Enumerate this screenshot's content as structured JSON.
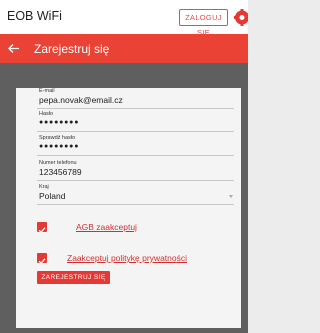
{
  "app": {
    "title": "EOB WiFi",
    "login_label": "ZALOGUJ SIĘ"
  },
  "header": {
    "title": "Zarejestruj się"
  },
  "form": {
    "email": {
      "label": "E-mail",
      "value": "pepa.novak@email.cz"
    },
    "password": {
      "label": "Hasło",
      "value": "●●●●●●●●"
    },
    "password_confirm": {
      "label": "Sprawdź hasło",
      "value": "●●●●●●●●"
    },
    "phone": {
      "label": "Numer telefonu",
      "value": "123456789"
    },
    "country": {
      "label": "Kraj",
      "value": "Poland"
    },
    "terms": {
      "label": "AGB zaakceptuj",
      "checked": true
    },
    "privacy": {
      "label": "Zaakceptuj politykę prywatności",
      "checked": true
    },
    "submit_label": "ZAREJESTRUJ SIĘ"
  },
  "colors": {
    "accent": "#ea4335",
    "panel": "#5f5f5f",
    "card": "#f4f4f4"
  },
  "icons": {
    "settings": "gear-icon",
    "back": "back-arrow-icon",
    "checkbox": "checkbox-checked-icon",
    "dropdown": "chevron-down-icon"
  }
}
